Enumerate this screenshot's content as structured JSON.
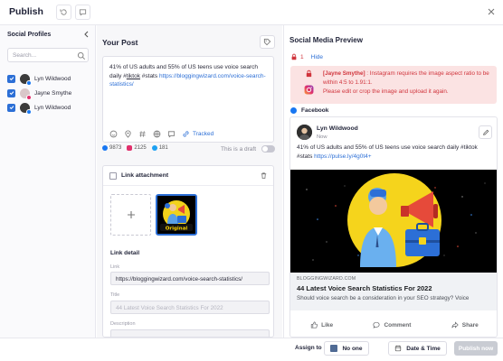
{
  "header": {
    "title": "Publish"
  },
  "sidebar": {
    "title": "Social Profiles",
    "search_placeholder": "Search...",
    "profiles": [
      {
        "name": "Lyn Wildwood",
        "network": "facebook"
      },
      {
        "name": "Jayne Smythe",
        "network": "instagram"
      },
      {
        "name": "Lyn Wildwood",
        "network": "facebook"
      }
    ]
  },
  "editor": {
    "title": "Your Post",
    "text_before": "41% of US adults and 55% of US teens use voice search daily #",
    "text_tag": "tiktok",
    "text_middle": " #stats ",
    "text_link": "https://bloggingwizard.com/voice-search-statistics/",
    "tracked_label": "Tracked",
    "counts": {
      "facebook": "9873",
      "instagram": "2125",
      "twitter": "181"
    },
    "draft_label": "This is a draft"
  },
  "link_attachment": {
    "title": "Link attachment",
    "detail_title": "Link detail",
    "link_label": "Link",
    "link_value": "https://bloggingwizard.com/voice-search-statistics/",
    "title_label": "Title",
    "title_placeholder": "44 Latest Voice Search Statistics For 2022",
    "description_label": "Description",
    "thumb_caption": "Original"
  },
  "preview": {
    "title": "Social Media Preview",
    "error_count": "1",
    "hide_label": "Hide",
    "error_name": "[Jayne Smythe]",
    "error_line1": " : Instagram requires the image aspect ratio to be within 4:5 to 1.91:1.",
    "error_line2": "Please edit or crop the image and upload it again.",
    "network_label": "Facebook",
    "author": "Lyn Wildwood",
    "time": "Now",
    "post_text": "41% of US adults and 55% of US teens use voice search daily #tiktok #stats ",
    "post_link": "https://pulse.ly/4g0t4+",
    "domain": "BLOGGINGWIZARD.COM",
    "headline": "44 Latest Voice Search Statistics For 2022",
    "description": "Should voice search be a consideration in your SEO strategy? Voice",
    "actions": {
      "like": "Like",
      "comment": "Comment",
      "share": "Share"
    }
  },
  "footer": {
    "assign_label": "Assign to",
    "assign_value": "No one",
    "datetime_label": "Date & Time",
    "publish_label": "Publish now"
  },
  "colors": {
    "accent": "#2c6fd6",
    "error": "#d0343c",
    "error_bg": "#fbe3e3",
    "facebook": "#1877f2",
    "instagram": "#e1306c",
    "twitter": "#1da1f2"
  }
}
